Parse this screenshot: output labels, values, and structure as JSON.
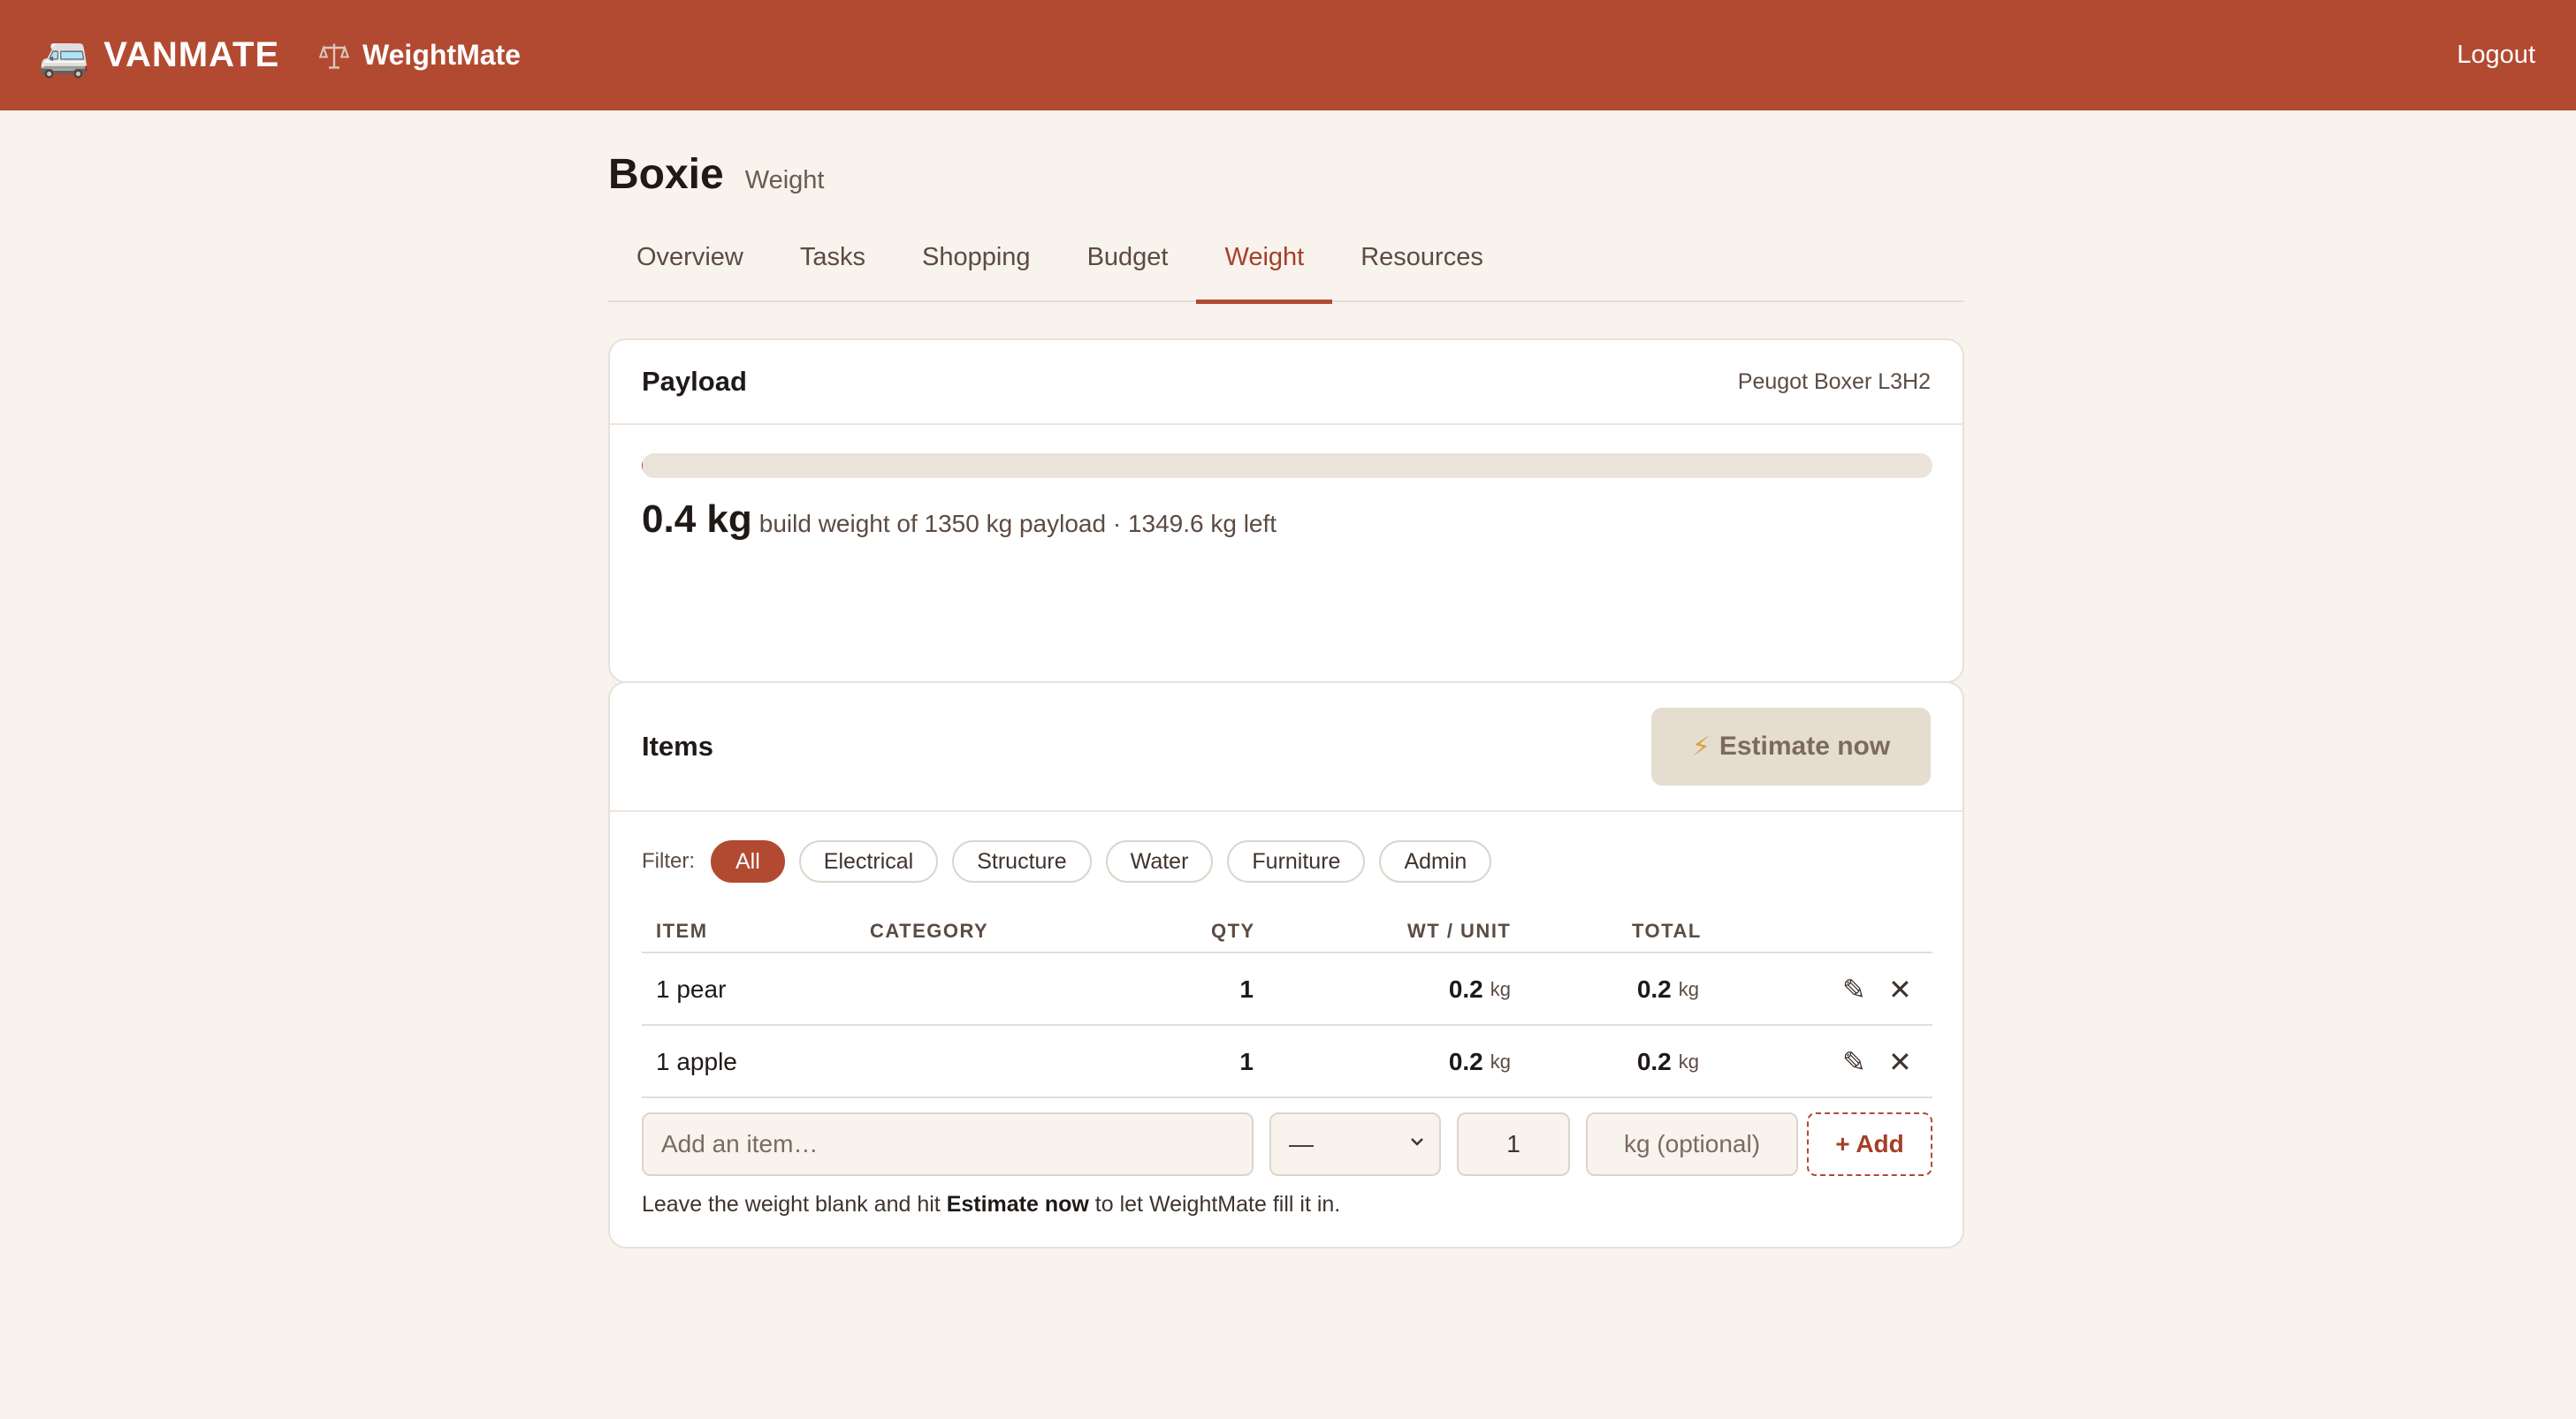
{
  "topbar": {
    "brand_icon": "🚐",
    "brand": "VANMATE",
    "app_icon": "scale-icon",
    "app_name": "WeightMate",
    "logout": "Logout",
    "color": "#b24a31"
  },
  "page": {
    "title": "Boxie",
    "subtitle": "Weight"
  },
  "tabs": [
    {
      "label": "Overview",
      "active": false
    },
    {
      "label": "Tasks",
      "active": false
    },
    {
      "label": "Shopping",
      "active": false
    },
    {
      "label": "Budget",
      "active": false
    },
    {
      "label": "Weight",
      "active": true
    },
    {
      "label": "Resources",
      "active": false
    }
  ],
  "payload": {
    "title": "Payload",
    "vehicle": "Peugot Boxer L3H2",
    "progress_fraction": 0.0003,
    "weight": "0.4 kg",
    "summary": "build weight of 1350 kg payload · 1349.6 kg left"
  },
  "items": {
    "title": "Items",
    "estimate_label": "Estimate now",
    "estimate_icon": "⚡",
    "filter_label": "Filter:",
    "filters": [
      {
        "label": "All",
        "active": true
      },
      {
        "label": "Electrical",
        "active": false
      },
      {
        "label": "Structure",
        "active": false
      },
      {
        "label": "Water",
        "active": false
      },
      {
        "label": "Furniture",
        "active": false
      },
      {
        "label": "Admin",
        "active": false
      }
    ],
    "columns": [
      "ITEM",
      "CATEGORY",
      "QTY",
      "WT / UNIT",
      "TOTAL"
    ],
    "rows": [
      {
        "item": "1 pear",
        "category": "",
        "qty": "1",
        "wt": "0.2",
        "wt_unit": "kg",
        "total": "0.2",
        "total_unit": "kg"
      },
      {
        "item": "1 apple",
        "category": "",
        "qty": "1",
        "wt": "0.2",
        "wt_unit": "kg",
        "total": "0.2",
        "total_unit": "kg"
      }
    ],
    "edit_icon": "✎",
    "delete_icon": "✕",
    "add": {
      "item_placeholder": "Add an item…",
      "category_value": "—",
      "qty_value": "1",
      "weight_placeholder": "kg (optional)",
      "add_label": "+ Add"
    },
    "hint_pre": "Leave the weight blank and hit ",
    "hint_bold": "Estimate now",
    "hint_post": " to let WeightMate fill it in."
  }
}
